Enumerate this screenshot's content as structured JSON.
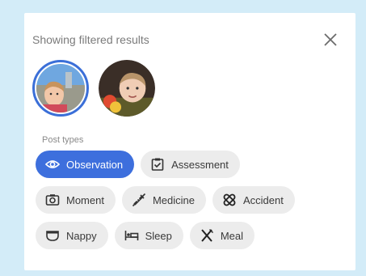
{
  "header": {
    "title": "Showing filtered results"
  },
  "filters": {
    "post_types_label": "Post types"
  },
  "chips": [
    {
      "label": "Observation",
      "icon": "eye-icon",
      "active": true
    },
    {
      "label": "Assessment",
      "icon": "checklist-icon",
      "active": false
    },
    {
      "label": "Moment",
      "icon": "camera-icon",
      "active": false
    },
    {
      "label": "Medicine",
      "icon": "syringe-icon",
      "active": false
    },
    {
      "label": "Accident",
      "icon": "bandage-icon",
      "active": false
    },
    {
      "label": "Nappy",
      "icon": "nappy-icon",
      "active": false
    },
    {
      "label": "Sleep",
      "icon": "bed-icon",
      "active": false
    },
    {
      "label": "Meal",
      "icon": "cutlery-icon",
      "active": false
    }
  ],
  "colors": {
    "accent": "#3d6fdd",
    "chip_bg": "#ececec",
    "page_bg": "#d3ecf8"
  }
}
